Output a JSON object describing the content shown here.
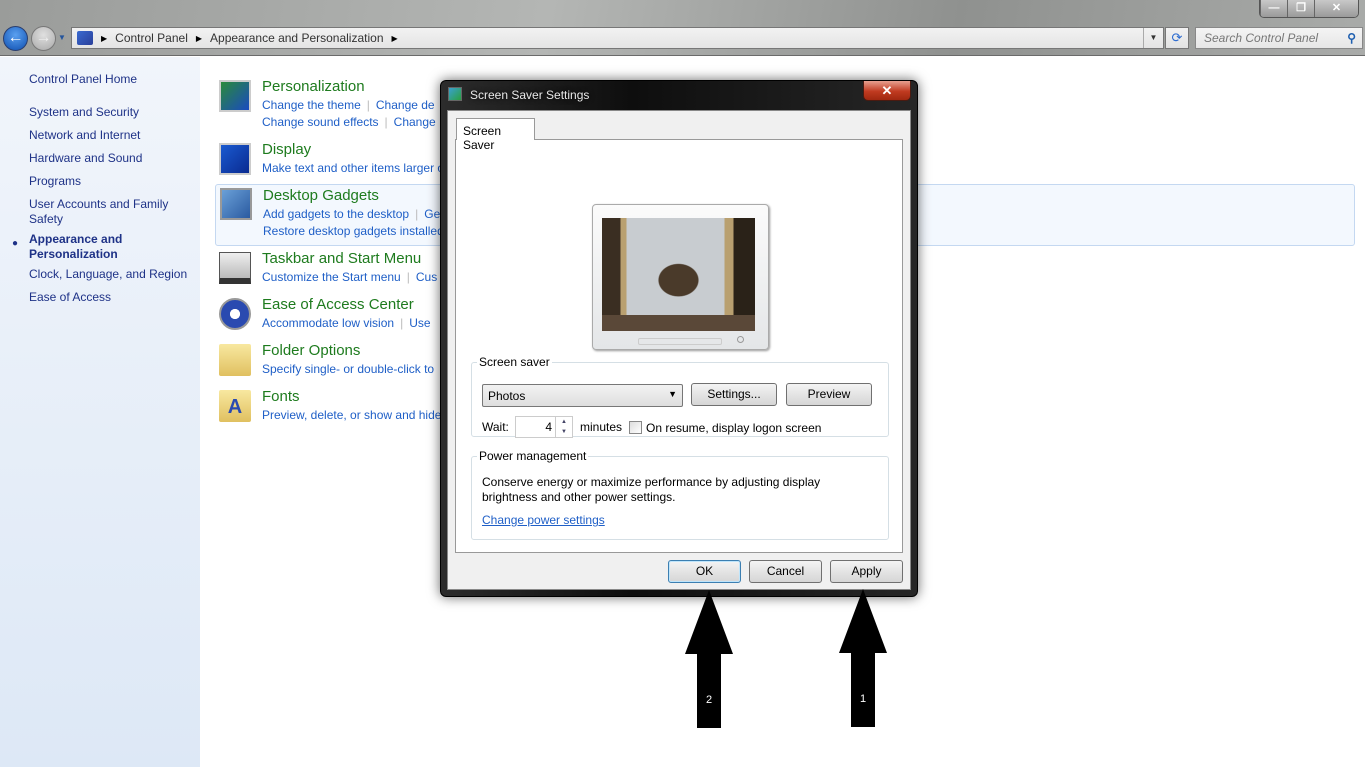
{
  "explorer": {
    "breadcrumb": [
      "Control Panel",
      "Appearance and Personalization"
    ],
    "search_placeholder": "Search Control Panel"
  },
  "sidebar": {
    "items": [
      {
        "label": "Control Panel Home"
      },
      {
        "label": "System and Security"
      },
      {
        "label": "Network and Internet"
      },
      {
        "label": "Hardware and Sound"
      },
      {
        "label": "Programs"
      },
      {
        "label": "User Accounts and Family Safety"
      },
      {
        "label": "Appearance and Personalization",
        "active": true
      },
      {
        "label": "Clock, Language, and Region"
      },
      {
        "label": "Ease of Access"
      }
    ]
  },
  "categories": [
    {
      "title": "Personalization",
      "icon": "personalization-icon",
      "links1": [
        "Change the theme",
        "Change de"
      ],
      "links2": [
        "Change sound effects",
        "Change"
      ]
    },
    {
      "title": "Display",
      "icon": "display-icon",
      "links1": [
        "Make text and other items larger o"
      ],
      "links2": []
    },
    {
      "title": "Desktop Gadgets",
      "icon": "gadgets-icon",
      "links1": [
        "Add gadgets to the desktop",
        "Ge"
      ],
      "links2": [
        "Restore desktop gadgets installed"
      ]
    },
    {
      "title": "Taskbar and Start Menu",
      "icon": "taskbar-icon",
      "links1": [
        "Customize the Start menu",
        "Cus"
      ],
      "links2": []
    },
    {
      "title": "Ease of Access Center",
      "icon": "ease-of-access-icon",
      "links1": [
        "Accommodate low vision",
        "Use"
      ],
      "links2": []
    },
    {
      "title": "Folder Options",
      "icon": "folder-icon",
      "links1": [
        "Specify single- or double-click to"
      ],
      "links2": []
    },
    {
      "title": "Fonts",
      "icon": "fonts-icon",
      "links1": [
        "Preview, delete, or show and hide"
      ],
      "links2": []
    }
  ],
  "dialog": {
    "title": "Screen Saver Settings",
    "tab": "Screen Saver",
    "screen_saver_group": "Screen saver",
    "selected_screensaver": "Photos",
    "settings_button": "Settings...",
    "preview_button": "Preview",
    "wait_label": "Wait:",
    "wait_value": "4",
    "minutes_label": "minutes",
    "logon_checkbox_label": "On resume, display logon screen",
    "logon_checked": false,
    "power_group": "Power management",
    "power_text": "Conserve energy or maximize performance by adjusting display brightness and other power settings.",
    "power_link": "Change power settings",
    "ok": "OK",
    "cancel": "Cancel",
    "apply": "Apply"
  },
  "annotations": [
    {
      "label": "2",
      "target": "OK"
    },
    {
      "label": "1",
      "target": "Apply"
    }
  ]
}
